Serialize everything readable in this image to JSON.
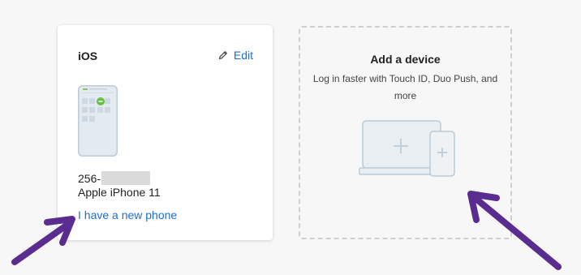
{
  "device_card": {
    "title": "iOS",
    "edit_label": "Edit",
    "phone_number_prefix": "256-",
    "device_model": "Apple iPhone 11",
    "new_phone_link": "I have a new phone",
    "icons": [
      "pencil-icon",
      "phone-illustration"
    ]
  },
  "add_device_card": {
    "title": "Add a device",
    "subtitle": "Log in faster with Touch ID, Duo Push, and more",
    "icons": [
      "laptop-icon",
      "phone-icon",
      "plus-icon"
    ]
  },
  "colors": {
    "link": "#1a6ed8",
    "annotation_arrow": "#5b2c8f",
    "background": "#f7f7f7"
  }
}
